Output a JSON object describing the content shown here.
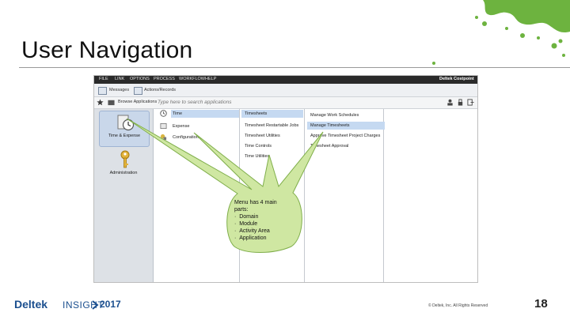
{
  "slide": {
    "title": "User Navigation",
    "page_number": "18",
    "copyright": "© Deltek, Inc. All Rights Reserved",
    "brand_name": "Deltek",
    "brand_event": "INSIGHT",
    "brand_year": "2017"
  },
  "app": {
    "menu": [
      "FILE",
      "LINK",
      "OPTIONS",
      "PROCESS",
      "WORKFLOW",
      "HELP"
    ],
    "brand": "Deltek Costpoint",
    "toolbar": {
      "messages": "Messages",
      "actions_records": "Actions/Records"
    },
    "browse_label": "Browse Applications",
    "search_placeholder": "Type here to search applications",
    "domains": [
      {
        "label": "Time & Expense"
      },
      {
        "label": "Administration"
      }
    ],
    "modules": [
      "Time",
      "Expense",
      "Configuration"
    ],
    "activity_areas": [
      "Timesheets",
      "Timesheet Restartable Jobs",
      "Timesheet Utilities",
      "Time Controls",
      "Time Utilities"
    ],
    "applications": [
      "Manage Work Schedules",
      "Manage Timesheets",
      "Approve Timesheet Project Charges",
      "Timesheet Approval"
    ]
  },
  "callout": {
    "heading": "Menu has 4 main parts:",
    "items": [
      "Domain",
      "Module",
      "Activity Area",
      "Application"
    ]
  },
  "colors": {
    "accent_green": "#6db33f",
    "deltek_blue": "#1b4f8f",
    "selection_blue": "#c5d9f1"
  }
}
